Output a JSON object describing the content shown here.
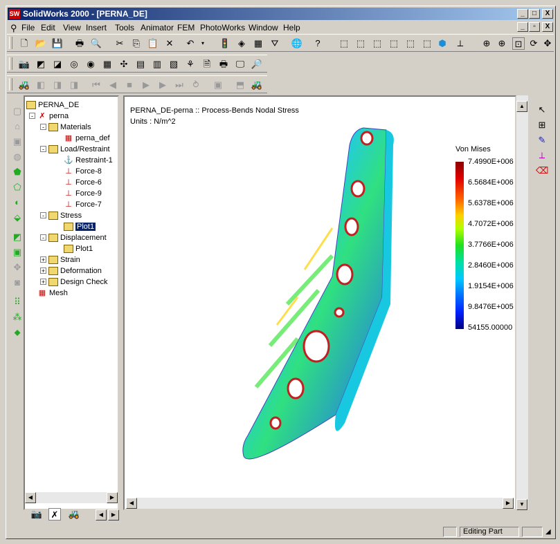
{
  "window": {
    "title": "SolidWorks 2000 - [PERNA_DE]",
    "app_icon": "SW"
  },
  "caption_buttons": [
    "_",
    "□",
    "X"
  ],
  "mdi_buttons": [
    "_",
    "▫",
    "X"
  ],
  "menu": [
    "File",
    "Edit",
    "View",
    "Insert",
    "Tools",
    "Animator",
    "FEM",
    "PhotoWorks",
    "Window",
    "Help"
  ],
  "tree": {
    "root": "PERNA_DE",
    "study": "perna",
    "materials": "Materials",
    "material_item": "perna_def",
    "load": "Load/Restraint",
    "loads": [
      "Restraint-1",
      "Force-8",
      "Force-6",
      "Force-9",
      "Force-7"
    ],
    "stress": "Stress",
    "stress_plot": "Plot1",
    "displacement": "Displacement",
    "disp_plot": "Plot1",
    "strain": "Strain",
    "deformation": "Deformation",
    "design_check": "Design Check",
    "mesh": "Mesh"
  },
  "viewport": {
    "title": "PERNA_DE-perna :: Process-Bends Nodal Stress",
    "units": "Units : N/m^2"
  },
  "legend": {
    "title": "Von Mises",
    "ticks": [
      "7.4990E+006",
      "6.5684E+006",
      "5.6378E+006",
      "4.7072E+006",
      "3.7766E+006",
      "2.8460E+006",
      "1.9154E+006",
      "9.8476E+005",
      "54155.00000"
    ]
  },
  "status": {
    "mode": "Editing Part"
  }
}
